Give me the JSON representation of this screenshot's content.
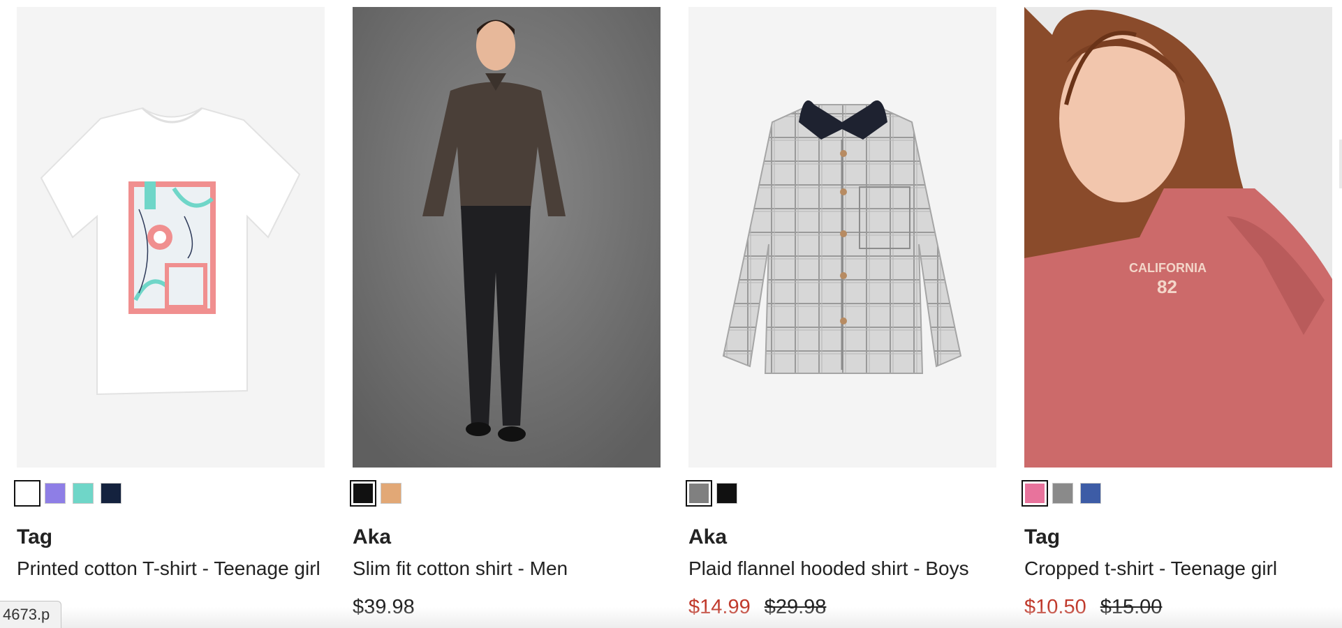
{
  "products": [
    {
      "brand": "Tag",
      "title": "Printed cotton T-shirt - Teenage girl",
      "price": "",
      "sale_price": "",
      "original_price": "",
      "swatches": [
        {
          "color": "#ffffff",
          "selected": true
        },
        {
          "color": "#8e7ee6",
          "selected": false
        },
        {
          "color": "#6fd6c8",
          "selected": false
        },
        {
          "color": "#14223e",
          "selected": false
        }
      ]
    },
    {
      "brand": "Aka",
      "title": "Slim fit cotton shirt - Men",
      "price": "$39.98",
      "sale_price": "",
      "original_price": "",
      "swatches": [
        {
          "color": "#111111",
          "selected": true
        },
        {
          "color": "#e2a876",
          "selected": false
        }
      ]
    },
    {
      "brand": "Aka",
      "title": "Plaid flannel hooded shirt - Boys",
      "price": "",
      "sale_price": "$14.99",
      "original_price": "$29.98",
      "swatches": [
        {
          "color": "#808080",
          "selected": true
        },
        {
          "color": "#111111",
          "selected": false
        }
      ]
    },
    {
      "brand": "Tag",
      "title": "Cropped t-shirt - Teenage girl",
      "price": "",
      "sale_price": "$10.50",
      "original_price": "$15.00",
      "swatches": [
        {
          "color": "#e8739c",
          "selected": true
        },
        {
          "color": "#8a8a8a",
          "selected": false
        },
        {
          "color": "#3d5ca6",
          "selected": false
        }
      ]
    }
  ],
  "status_bar": {
    "url_fragment": "4673.p"
  },
  "colors": {
    "sale": "#c0392b",
    "text": "#222222"
  }
}
